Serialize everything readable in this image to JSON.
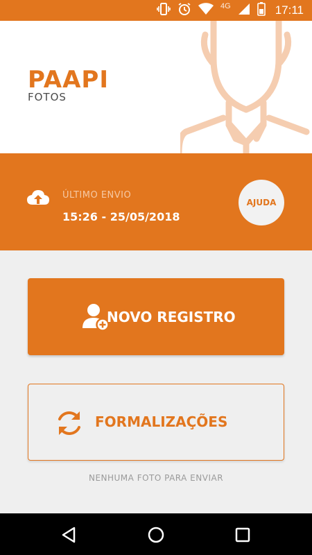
{
  "status_bar": {
    "network": "4G",
    "time": "17:11",
    "icons": [
      "vibrate-icon",
      "alarm-icon",
      "wifi-icon",
      "signal-icon",
      "battery-icon"
    ]
  },
  "brand": {
    "title": "PAAPI",
    "subtitle": "FOTOS"
  },
  "last_upload": {
    "label": "ÚLTIMO ENVIO",
    "value": "15:26 - 25/05/2018",
    "icon": "cloud-upload-icon"
  },
  "help_button": {
    "label": "AJUDA"
  },
  "actions": {
    "new_record": {
      "label": "NOVO REGISTRO",
      "icon": "add-user-icon"
    },
    "formalizations": {
      "label": "FORMALIZAÇÕES",
      "icon": "sync-icon"
    }
  },
  "queue_status": "NENHUMA FOTO PARA ENVIAR",
  "nav": {
    "icons": [
      "back-icon",
      "home-icon",
      "recents-icon"
    ]
  },
  "colors": {
    "accent": "#e2761e",
    "background": "#efefef",
    "muted_text": "#9a9a9a"
  }
}
